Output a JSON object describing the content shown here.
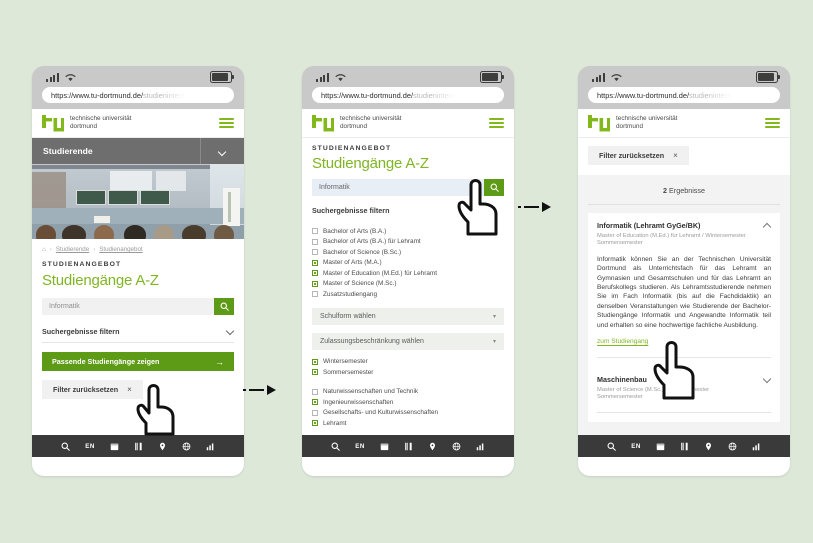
{
  "figure": {
    "background_color": "#dde8d9",
    "brand_green": "#7fb522",
    "button_green": "#5d9a15",
    "connector_arrows": [
      "dashed-arrow-1",
      "dashed-arrow-2"
    ]
  },
  "browser": {
    "url_visible": "https://www.tu-dortmund.de/",
    "url_faded": "studieninteres",
    "status_icons": [
      "signal-bars",
      "wifi",
      "battery"
    ]
  },
  "site": {
    "logo_mark": "tu",
    "logo_line1": "technische universität",
    "logo_line2": "dortmund",
    "menu_icon": "hamburger-menu"
  },
  "footer_icons": [
    {
      "name": "search-icon",
      "label": ""
    },
    {
      "name": "language-icon",
      "label": "EN"
    },
    {
      "name": "calendar-icon",
      "label": ""
    },
    {
      "name": "canteen-icon",
      "label": ""
    },
    {
      "name": "location-pin-icon",
      "label": ""
    },
    {
      "name": "globe-icon",
      "label": ""
    },
    {
      "name": "chart-icon",
      "label": ""
    }
  ],
  "phone1": {
    "section_bar": "Studierende",
    "hero_alt": "lecture-hall-photo",
    "breadcrumb": {
      "home": "home-icon",
      "items": [
        "Studierende",
        "Studienangebot"
      ],
      "separator": "›"
    },
    "kicker": "STUDIENANGEBOT",
    "title": "Studiengänge A-Z",
    "search_value": "Informatik",
    "search_button": "search-icon",
    "filter_accordion": "Suchergebnisse filtern",
    "primary_button": "Passende Studiengänge zeigen",
    "primary_button_arrow": "→",
    "reset_button": "Filter zurücksetzen",
    "reset_button_x": "×"
  },
  "phone2": {
    "kicker": "STUDIENANGEBOT",
    "title": "Studiengänge A-Z",
    "search_value": "Informatik",
    "search_button": "search-icon",
    "filter_heading": "Suchergebnisse filtern",
    "degree_filters": [
      {
        "label": "Bachelor of Arts (B.A.)",
        "checked": false
      },
      {
        "label": "Bachelor of Arts (B.A.) für Lehramt",
        "checked": false
      },
      {
        "label": "Bachelor of Science (B.Sc.)",
        "checked": false
      },
      {
        "label": "Master of Arts (M.A.)",
        "checked": true
      },
      {
        "label": "Master of Education (M.Ed.) für Lehramt",
        "checked": true
      },
      {
        "label": "Master of Science (M.Sc.)",
        "checked": true
      },
      {
        "label": "Zusatzstudiengang",
        "checked": false
      }
    ],
    "select_schulform": "Schulform wählen",
    "select_zulassung": "Zulassungsbeschränkung wählen",
    "semester_filters": [
      {
        "label": "Wintersemester",
        "checked": true
      },
      {
        "label": "Sommersemester",
        "checked": true
      }
    ],
    "subject_filters": [
      {
        "label": "Naturwissenschaften und Technik",
        "checked": false
      },
      {
        "label": "Ingenieurwissenschaften",
        "checked": true
      },
      {
        "label": "Gesellschafts- und Kulturwissenschaften",
        "checked": false
      },
      {
        "label": "Lehramt",
        "checked": true
      }
    ]
  },
  "phone3": {
    "reset_button": "Filter zurücksetzen",
    "reset_button_x": "×",
    "result_count_number": "2",
    "result_count_label": "Ergebnisse",
    "results": [
      {
        "title": "Informatik (Lehramt GyGe/BK)",
        "subtitle_line1": "Master of Education (M.Ed.) für Lehramt / Wintersemester",
        "subtitle_line2": "Sommersemester",
        "expanded": true,
        "chevron": "chevron-up-icon",
        "body": "Informatik können Sie an der Technischen Universität Dortmund als Unterrichtsfach für das Lehramt an Gymnasien und Gesamtschulen und für das Lehramt an Berufskollegs studieren. Als Lehramtsstudierende nehmen Sie im Fach Informatik (bis auf die Fachdidaktik) an denselben Veranstaltungen wie Studierende der Bachelor-Studiengänge Informatik und Angewandte Informatik teil und erhalten so eine hochwertige fachliche Ausbildung.",
        "link": "zum Studiengang"
      },
      {
        "title": "Maschinenbau",
        "subtitle_line1": "Master of Science (M.Sc.) / Wintersemester",
        "subtitle_line2": "Sommersemester",
        "expanded": false,
        "chevron": "chevron-down-icon",
        "body": "",
        "link": ""
      }
    ]
  }
}
